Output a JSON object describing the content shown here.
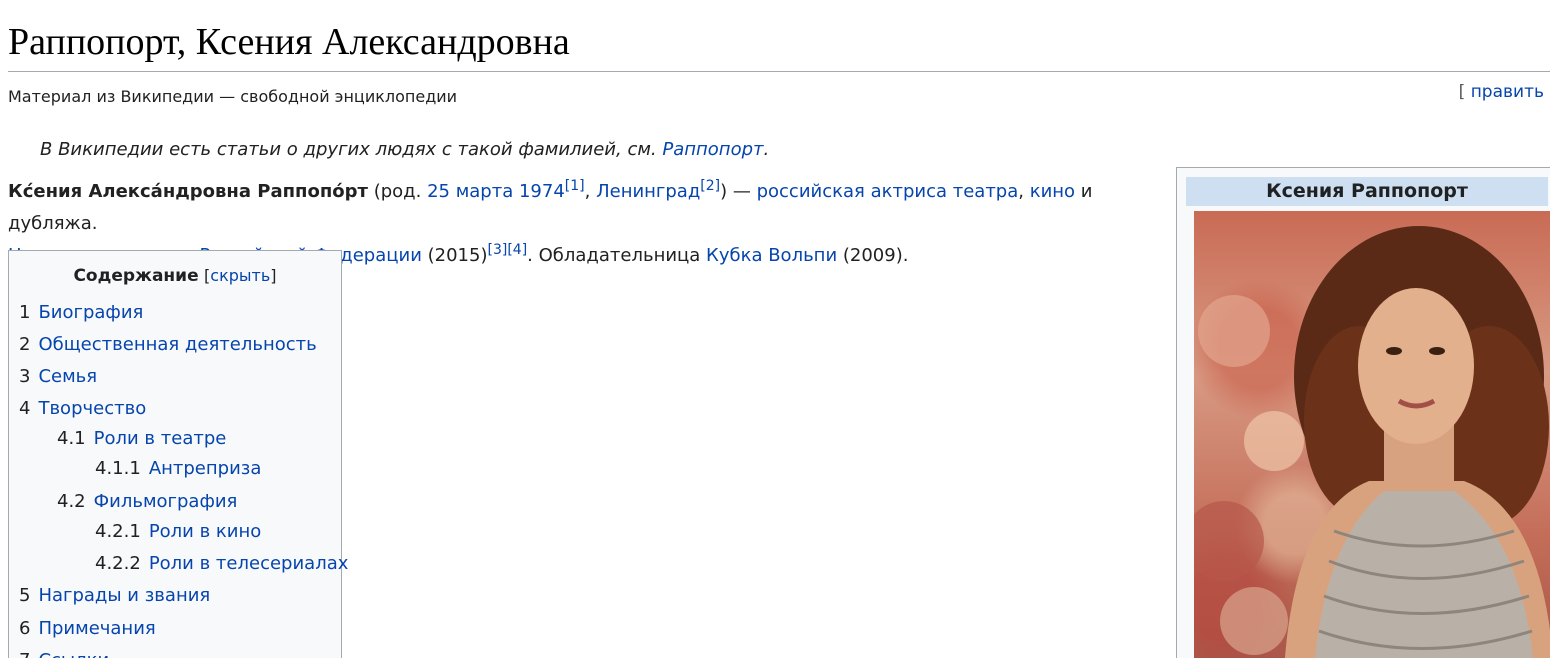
{
  "page": {
    "title": "Раппопорт, Ксения Александровна",
    "tagline": "Материал из Википедии — свободной энциклопедии",
    "edit_bracket": "[",
    "edit_label": "править"
  },
  "hatnote": {
    "text": "В Википедии есть статьи о других людях с такой фамилией, см. ",
    "link": "Раппопорт",
    "end": "."
  },
  "lead": {
    "name": "Кс́ения Алекса́ндровна Раппопо́рт",
    "t1": " (род. ",
    "birth_date": "25 марта 1974",
    "ref1": "[1]",
    "t2": ", ",
    "birth_place": "Ленинград",
    "ref2": "[2]",
    "t3": ") — ",
    "link_actress": "российская актриса театра",
    "t4": ", ",
    "link_cinema": "кино",
    "t5": " и дубляжа.",
    "link_title": "Народная артистка Российской Федерации",
    "t6": " (2015)",
    "ref3": "[3]",
    "ref4": "[4]",
    "t7": ". Обладательница ",
    "link_award": "Кубка Вольпи",
    "t8": " (2009)."
  },
  "toc": {
    "heading": "Содержание",
    "toggle_open": "[",
    "toggle_label": "скрыть",
    "toggle_close": "]",
    "items": [
      {
        "num": "1",
        "label": "Биография"
      },
      {
        "num": "2",
        "label": "Общественная деятельность"
      },
      {
        "num": "3",
        "label": "Семья"
      },
      {
        "num": "4",
        "label": "Творчество"
      },
      {
        "num": "4.1",
        "label": "Роли в театре"
      },
      {
        "num": "4.1.1",
        "label": "Антреприза"
      },
      {
        "num": "4.2",
        "label": "Фильмография"
      },
      {
        "num": "4.2.1",
        "label": "Роли в кино"
      },
      {
        "num": "4.2.2",
        "label": "Роли в телесериалах"
      },
      {
        "num": "5",
        "label": "Награды и звания"
      },
      {
        "num": "6",
        "label": "Примечания"
      },
      {
        "num": "7",
        "label": "Ссылки"
      }
    ]
  },
  "infobox": {
    "header": "Ксения Раппопорт"
  }
}
